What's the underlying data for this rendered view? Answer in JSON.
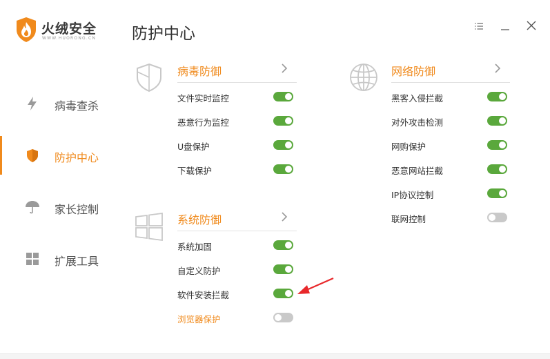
{
  "app": {
    "logo_text": "火绒安全",
    "logo_sub": "WWW.HUORONG.CN",
    "page_title": "防护中心"
  },
  "colors": {
    "accent": "#f08a1c",
    "toggle_on": "#5aa83c",
    "toggle_off": "#c9c9c9"
  },
  "window_controls": [
    "menu-icon",
    "minimize-icon",
    "close-icon"
  ],
  "sidebar": {
    "items": [
      {
        "label": "病毒查杀",
        "icon": "lightning-icon",
        "active": false
      },
      {
        "label": "防护中心",
        "icon": "shield-icon",
        "active": true
      },
      {
        "label": "家长控制",
        "icon": "umbrella-icon",
        "active": false
      },
      {
        "label": "扩展工具",
        "icon": "grid-icon",
        "active": false
      }
    ]
  },
  "sections": {
    "virus": {
      "title": "病毒防御",
      "icon": "shield-outline-icon",
      "items": [
        {
          "label": "文件实时监控",
          "on": true
        },
        {
          "label": "恶意行为监控",
          "on": true
        },
        {
          "label": "U盘保护",
          "on": true
        },
        {
          "label": "下载保护",
          "on": true
        }
      ]
    },
    "system": {
      "title": "系统防御",
      "icon": "windows-icon",
      "items": [
        {
          "label": "系统加固",
          "on": true
        },
        {
          "label": "自定义防护",
          "on": true
        },
        {
          "label": "软件安装拦截",
          "on": true
        },
        {
          "label": "浏览器保护",
          "on": false,
          "highlight": true
        }
      ]
    },
    "network": {
      "title": "网络防御",
      "icon": "globe-icon",
      "items": [
        {
          "label": "黑客入侵拦截",
          "on": true
        },
        {
          "label": "对外攻击检测",
          "on": true
        },
        {
          "label": "网购保护",
          "on": true
        },
        {
          "label": "恶意网站拦截",
          "on": true
        },
        {
          "label": "IP协议控制",
          "on": true
        },
        {
          "label": "联网控制",
          "on": false
        }
      ]
    }
  }
}
